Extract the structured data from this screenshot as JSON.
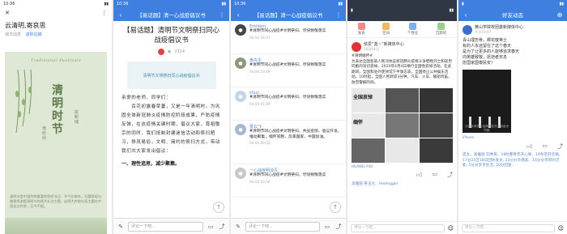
{
  "colors": {
    "accent": "#3f7fe0",
    "dark_header": "#2e3743",
    "poster_bg": "#dfe8d4"
  },
  "phone1": {
    "status_time": "10:36",
    "close_icon": "close-icon",
    "menu_icon": "more-icon",
    "title": "云清明,寄哀思",
    "meta_author": "城市动态",
    "meta_tag": "进阶征稿",
    "poster_banner": "Traditional Festivals",
    "poster_big": "清明时节",
    "poster_vert1": "雨纷纷",
    "poster_vert2": "欲断魂",
    "poster_foot": "清明节是中国传统重要的祭祀节日，节气在每年。扫墓祭祖与踏青郊游是清明节的两大礼仪主题，这两大传统礼俗主题在中国自古传承，至今不辍。"
  },
  "phone2": {
    "status_time": "10:36",
    "back_icon": "back-icon",
    "bar_title": "【易话题】清一心战疫倡议书",
    "more_icon": "more-icon",
    "headline": "【易话题】清明节文明祭扫同心战疫倡议书",
    "views": "2314",
    "mini_banner": "清明节文明祭扫同心战疫倡议书",
    "body": "亲爱的老师、同学们：\n　　百花初露春草萋，又是一年清明时。为巩固全体新冠肺炎疫情防控阶段成果，严防疫情反弹，在这疫情关键时期，倡议大家，尊祖敬宗的同时，我们抵制封建迷信活动和祭扫陋习，移风易俗，文明、简约的祭扫方式，带动我们共大家发出倡议：",
    "sub": "一、理性追思，减少聚集。",
    "input_placeholder": "评论一下吧...",
    "fab": "↑"
  },
  "phone3": {
    "status_time": "10:36",
    "bar_title": "【易话题】清一心战疫倡议书",
    "comments": [
      {
        "name": "Emiliem..",
        "text": "#清明节同心战疫#文明祭扫，尽快致敬落实",
        "time": "04-04 16:47"
      },
      {
        "name": "黄先生",
        "text": "#清明节同心战疫#文明祭扫，尽快致敬落实",
        "time": "04-04 10:09"
      },
      {
        "name": "shuz..",
        "text": "#清明节同心战疫#文明祭扫，尽快致敬落实",
        "time": "04-04 01:09"
      },
      {
        "name": "曹云飞",
        "text": "#清明节同心战疫#文明祭扫，共战疫情，倡议开发，推动聚集，缅怀同胞，反美国家，中国加油。",
        "time": "04-04 00:02"
      },
      {
        "name": "一心战疫明消灭",
        "text": "#清明节同心战疫#文明祭扫，尽快致敬落实",
        "time": "04-03 23:56"
      }
    ],
    "input_placeholder": "评论一下吧..."
  },
  "phone4": {
    "bar_title": "好友动态",
    "tabs": [
      "发表",
      "空间",
      "个性化",
      "沉默的"
    ],
    "author": "侬爱“蓝☆”新媒体中心",
    "date": "04月04日",
    "text": "#清明缅怀#\n为表达全国各族人民对抗击新冠肺炎疫情斗争牺牲烈士和逝世同胞的深切哀悼，2020年4月4日举行全国性哀悼活动。在此期间，全国和驻外使领馆下半旗志哀，全国停止公共娱乐活动。10时起，全国人民默哀3分钟，汽车、火车、舰船鸣笛，防空警报鸣响。",
    "tiles": [
      "全国哀悼",
      "",
      "",
      "缅怀",
      "",
      "",
      "",
      "",
      ""
    ],
    "location": "HUAWEI P30",
    "likes": "高雅丽 茶玉兰、Heidegger",
    "input_placeholder": "评论一下吧..."
  },
  "phone5": {
    "bar_title": "好友动态",
    "author": "黄山学院校团委新媒体中心",
    "date": "今天10:07",
    "text": "青山埋忠骨，卿花敬英士\n有的人永远留在了这个春天\n是为了让更多的人能够追求春天\n向英雄致敬，愿逝者安息\n愿国家国泰民安！",
    "photo_caption": "沉痛哀悼抗击疫情牺牲烈士和逝世同胞",
    "location": "iPhone",
    "likes": "庞女、高雅丽 刘秀英、18时都青年开心果、19条范开云稿、17分21区18日团体发光, 23分分享朋友、16分分享新的可能, 1分分享享生活, 30分回复...",
    "input_placeholder": "评论一下吧..."
  }
}
